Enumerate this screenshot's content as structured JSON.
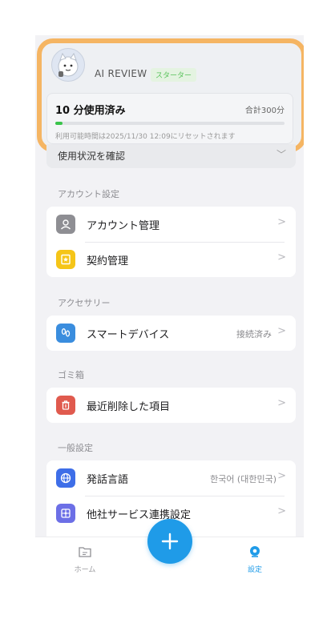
{
  "profile": {
    "brand": "AI REVIEW",
    "plan": "スターター",
    "usage_used": "10 分使用済み",
    "usage_total": "合計300分",
    "usage_fraction": 0.033,
    "reset_note": "利用可能時間は2025/11/30 12:09にリセットされます",
    "check_usage": "使用状況を確認"
  },
  "sections": {
    "account": "アカウント設定",
    "accessory": "アクセサリー",
    "trash": "ゴミ箱",
    "general": "一般設定"
  },
  "rows": {
    "account_management": "アカウント管理",
    "contract_management": "契約管理",
    "smart_device": "スマートデバイス",
    "smart_device_status": "接続済み",
    "recently_deleted": "最近削除した項目",
    "speech_language": "発話言語",
    "speech_language_value": "한국어 (대한민국)",
    "integration": "他社サービス連携設定"
  },
  "tabs": {
    "home": "ホーム",
    "settings": "設定"
  },
  "colors": {
    "highlight": "#f5b563",
    "accent": "#1f9be8",
    "progress": "#3ac44b"
  }
}
